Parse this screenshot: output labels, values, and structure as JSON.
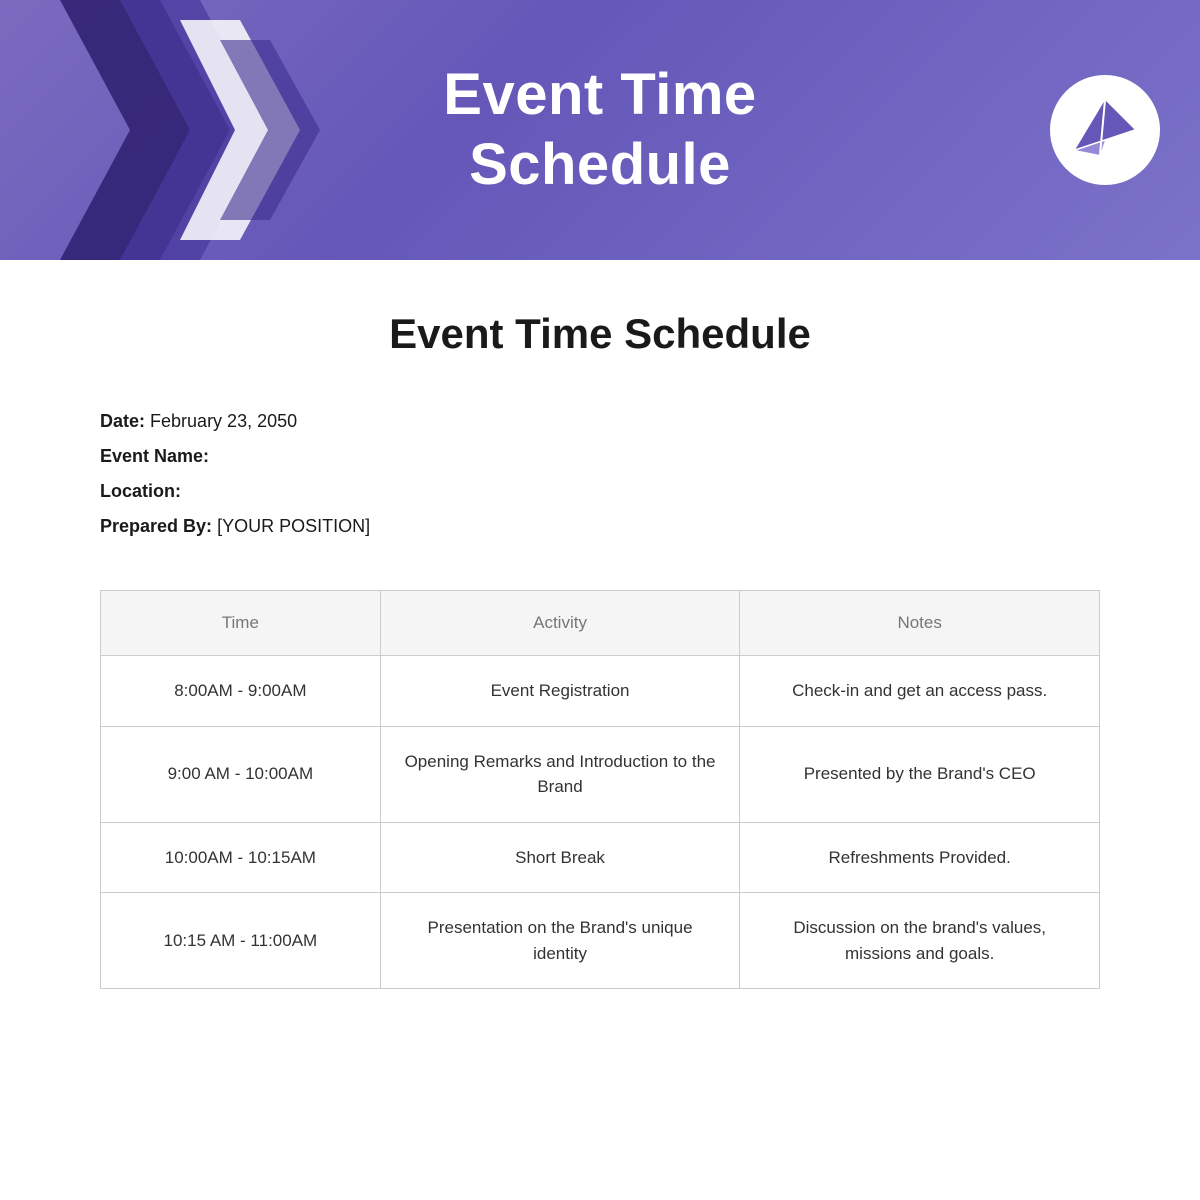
{
  "header": {
    "title_line1": "Event Time",
    "title_line2": "Schedule",
    "bg_color": "#6e63b8"
  },
  "document": {
    "title": "Event Time Schedule",
    "meta": {
      "date_label": "Date:",
      "date_value": "February 23, 2050",
      "event_name_label": "Event Name:",
      "event_name_value": "",
      "location_label": "Location:",
      "location_value": "",
      "prepared_by_label": "Prepared By:",
      "prepared_by_value": "[YOUR POSITION]"
    }
  },
  "table": {
    "headers": {
      "time": "Time",
      "activity": "Activity",
      "notes": "Notes"
    },
    "rows": [
      {
        "time": "8:00AM - 9:00AM",
        "activity": "Event Registration",
        "notes": "Check-in and get an access pass."
      },
      {
        "time": "9:00 AM - 10:00AM",
        "activity": "Opening Remarks and Introduction to the Brand",
        "notes": "Presented by the Brand's CEO"
      },
      {
        "time": "10:00AM - 10:15AM",
        "activity": "Short Break",
        "notes": "Refreshments Provided."
      },
      {
        "time": "10:15 AM - 11:00AM",
        "activity": "Presentation on the Brand's unique identity",
        "notes": "Discussion on the brand's values, missions and goals."
      }
    ]
  }
}
